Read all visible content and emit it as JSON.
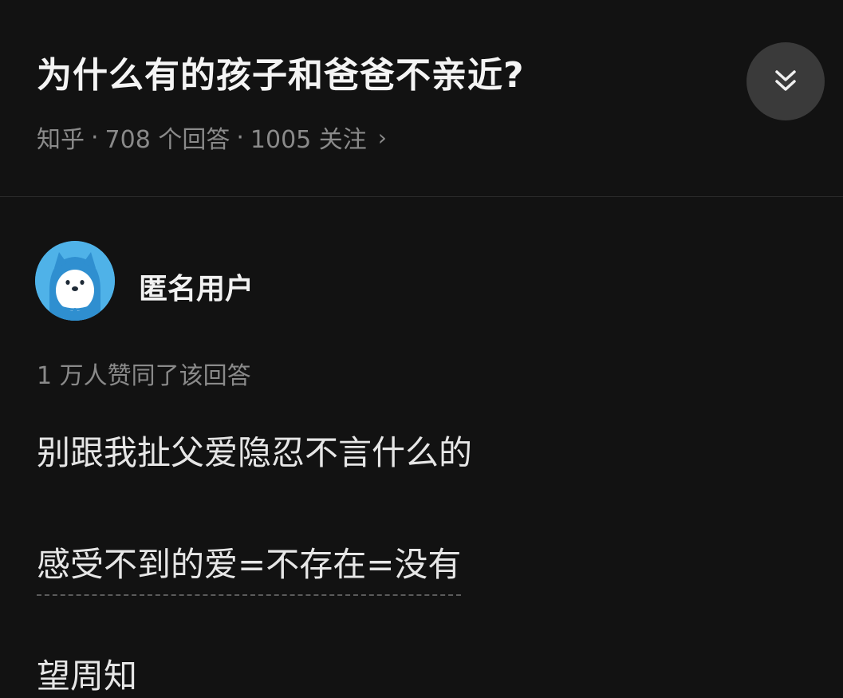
{
  "question": {
    "title": "为什么有的孩子和爸爸不亲近?",
    "source": "知乎",
    "separator": "·",
    "answers": "708 个回答",
    "followers": "1005 关注",
    "chevron": "›"
  },
  "expand_button": {
    "icon": "double-chevron-down-icon"
  },
  "answer": {
    "author": "匿名用户",
    "avatar_icon": "anonymous-dog-avatar-icon",
    "votes": "1 万人赞同了该回答",
    "paragraphs": [
      "别跟我扯父爱隐忍不言什么的",
      "感受不到的爱=不存在=没有",
      "望周知"
    ]
  },
  "colors": {
    "background": "#121212",
    "avatar_bg": "#4fb2e8",
    "muted_text": "#8a8a8a",
    "button_bg": "#3a3a3a"
  }
}
